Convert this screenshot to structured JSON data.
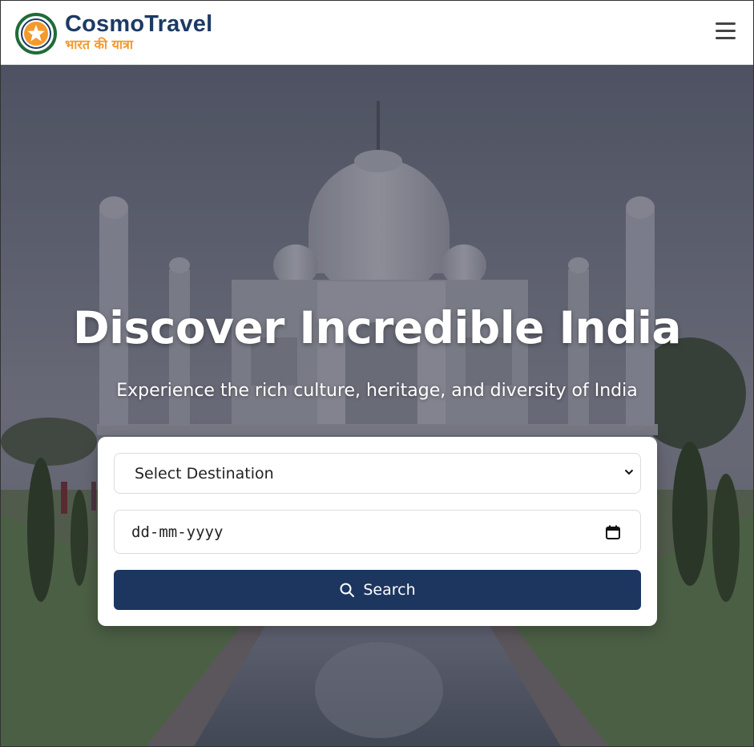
{
  "header": {
    "brand_title": "CosmoTravel",
    "brand_subtitle": "भारत की यात्रा",
    "logo_icon": "star-badge-icon",
    "menu_icon": "hamburger-menu-icon"
  },
  "hero": {
    "title": "Discover Incredible India",
    "subtitle": "Experience the rich culture, heritage, and diversity of India",
    "background": "taj-mahal-photo"
  },
  "search": {
    "destination_selected": "Select Destination",
    "date_placeholder": "dd-mm-yyyy",
    "search_label": "Search",
    "search_icon": "magnifier-icon"
  },
  "colors": {
    "brand_navy": "#1c3a63",
    "brand_orange": "#f39a2d",
    "logo_green": "#1f6b3a",
    "button_bg": "#1c3660"
  }
}
